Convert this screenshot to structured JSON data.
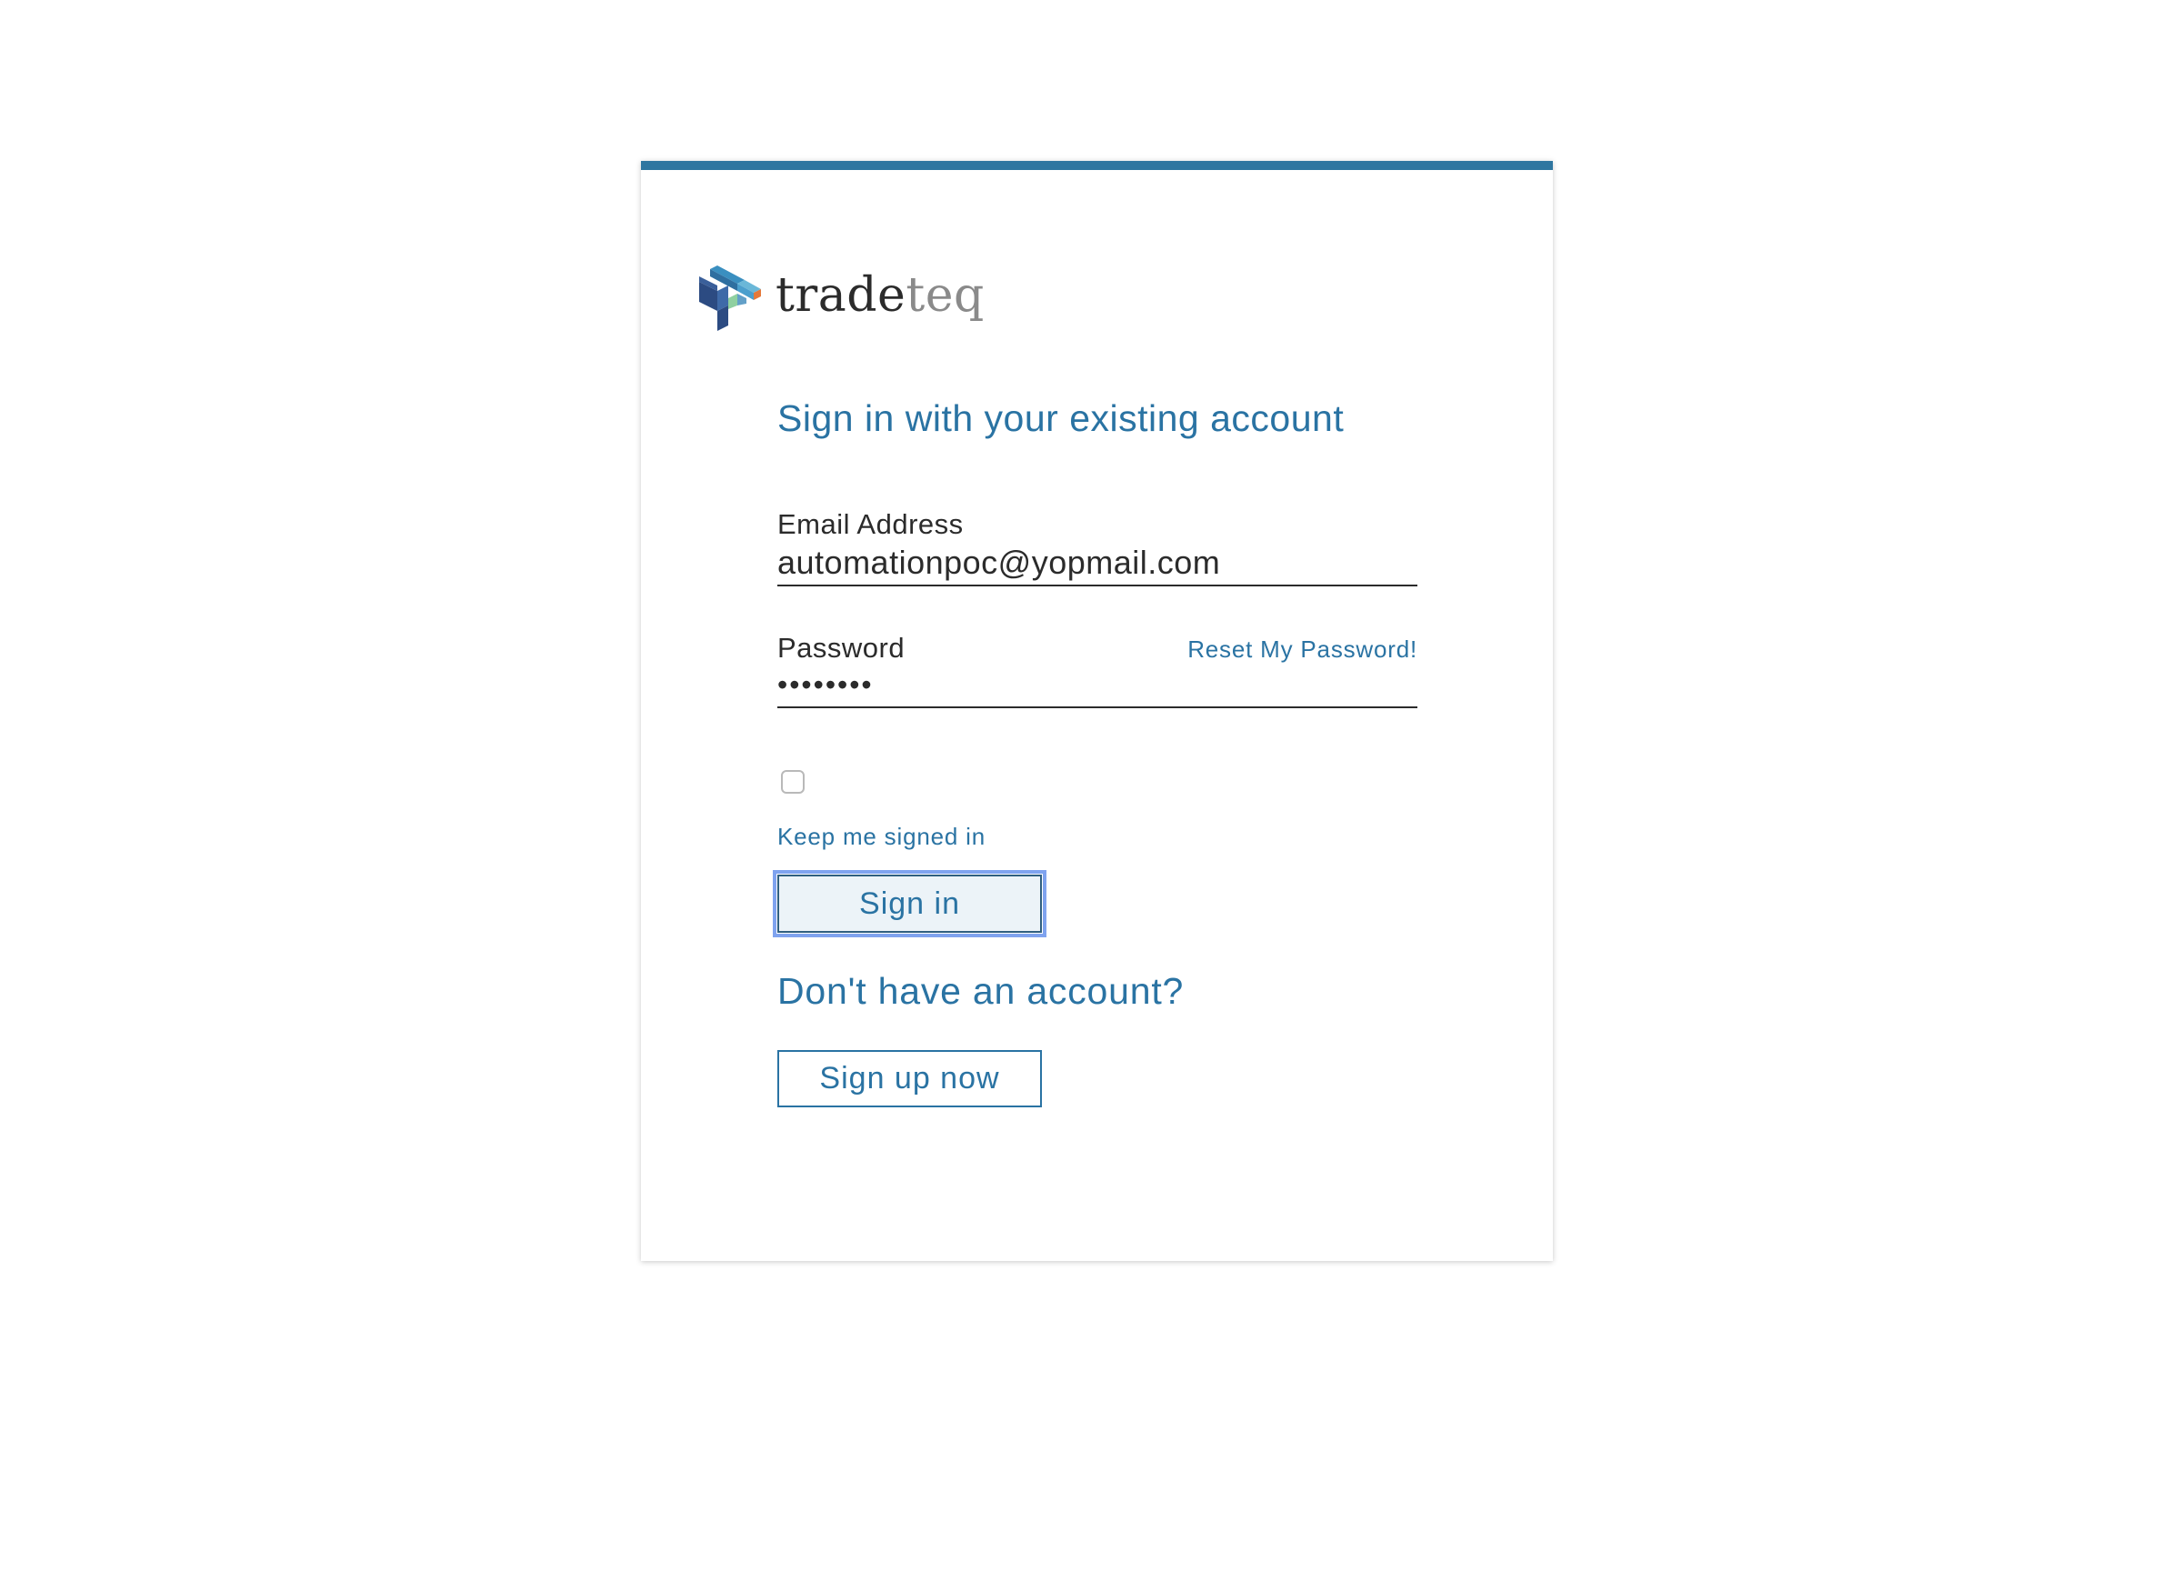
{
  "brand": {
    "logo_text_primary": "trade",
    "logo_text_secondary": "teq",
    "accent_color": "#2f76a0",
    "link_color": "#2a73a3"
  },
  "signin": {
    "heading": "Sign in with your existing account",
    "email_label": "Email Address",
    "email_value": "automationpoc@yopmail.com",
    "password_label": "Password",
    "password_value": "••••••••",
    "reset_link": "Reset My Password!",
    "keep_signed_in_label": "Keep me signed in",
    "keep_signed_in_checked": false,
    "signin_button": "Sign in"
  },
  "signup": {
    "heading": "Don't have an account?",
    "button": "Sign up now"
  }
}
